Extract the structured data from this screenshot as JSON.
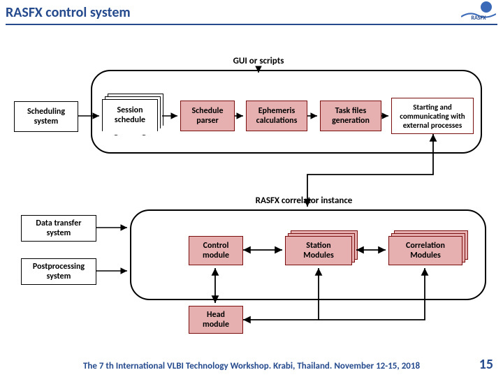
{
  "title": "RASFX control system",
  "logo": "RASFX",
  "outer": {
    "gui": "GUI or scripts",
    "scheduling": "Scheduling\nsystem",
    "session_schedule": "Session\nschedule",
    "schedule_parser": "Schedule\nparser",
    "ephemeris": "Ephemeris\ncalculations",
    "task_files": "Task files\ngeneration",
    "starting": "Starting and\ncommunicating with\nexternal processes"
  },
  "bottom": {
    "rasfx_label": "RASFX correlator instance",
    "data_transfer": "Data transfer\nsystem",
    "postprocessing": "Postprocessing\nsystem",
    "control_module": "Control\nmodule",
    "station_modules": "Station\nModules",
    "correlation_modules": "Correlation\nModules",
    "head_module": "Head\nmodule"
  },
  "footer": "The 7 th International VLBI Technology Workshop. Krabi, Thailand. November 12-15, 2018",
  "page": "15"
}
